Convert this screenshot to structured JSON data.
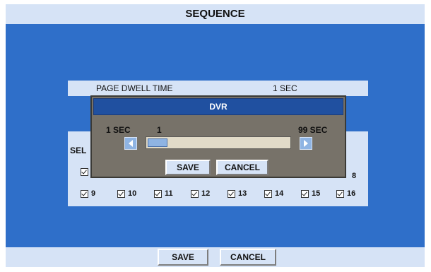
{
  "title": "SEQUENCE",
  "page_dwell": {
    "label": "PAGE DWELL TIME",
    "value": "1 SEC"
  },
  "select_label": "SEL",
  "cameras_row2": [
    "9",
    "10",
    "11",
    "12",
    "13",
    "14",
    "15",
    "16"
  ],
  "camera_partial": "8",
  "dialog": {
    "title": "DVR",
    "min_label": "1 SEC",
    "max_label": "99 SEC",
    "current": "1",
    "slider_fraction": 0.01,
    "save": "SAVE",
    "cancel": "CANCEL"
  },
  "footer": {
    "save": "SAVE",
    "cancel": "CANCEL"
  },
  "colors": {
    "screen": "#2f6fc9",
    "panel": "#d6e3f6",
    "dialog": "#777269",
    "dialog_title": "#2050a0"
  }
}
